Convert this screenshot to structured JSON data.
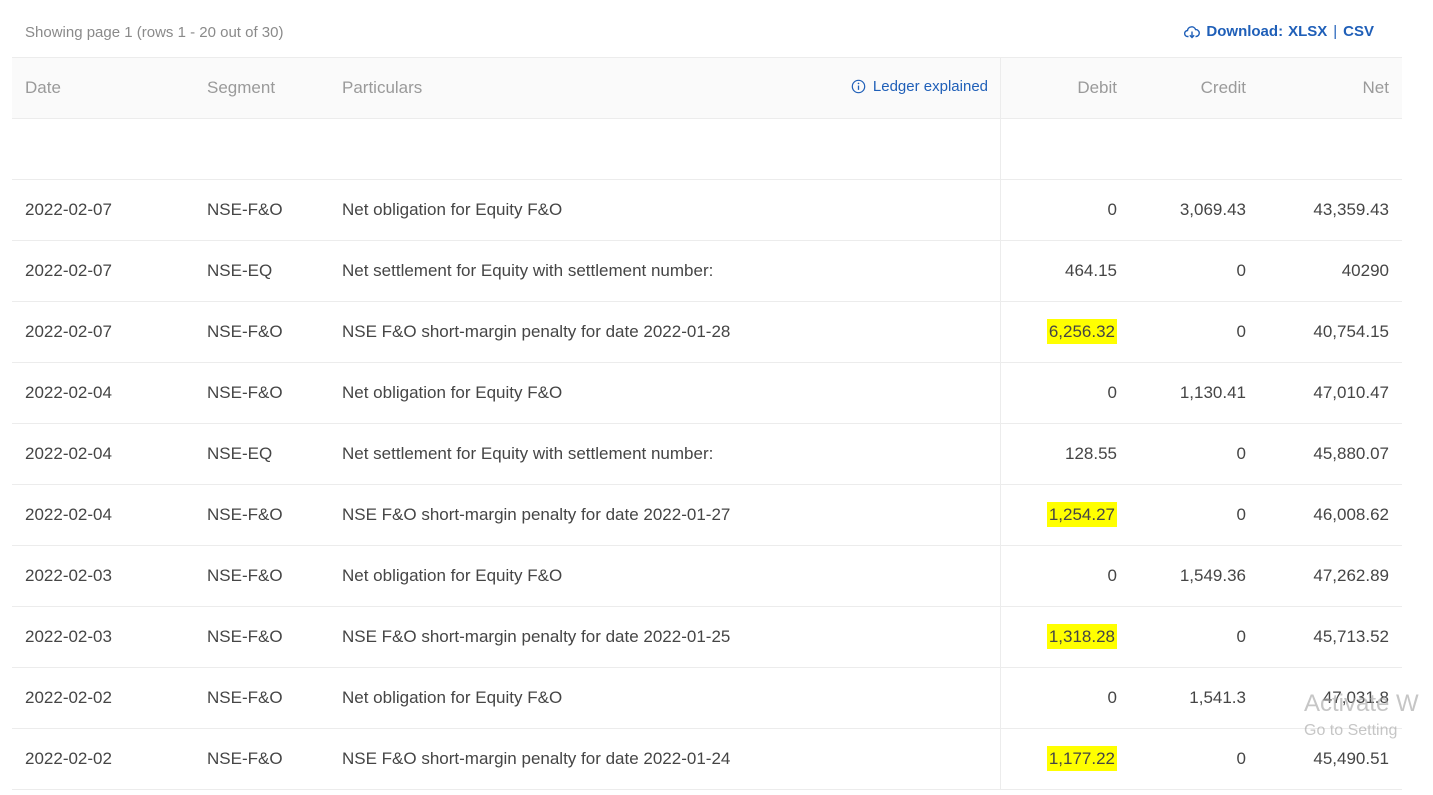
{
  "header": {
    "page_info": "Showing page 1 (rows 1 - 20 out of 30)",
    "download_label": "Download:",
    "xlsx": "XLSX",
    "separator": "|",
    "csv": "CSV"
  },
  "table": {
    "columns": {
      "date": "Date",
      "segment": "Segment",
      "particulars": "Particulars",
      "ledger_explained": "Ledger explained",
      "debit": "Debit",
      "credit": "Credit",
      "net": "Net"
    },
    "rows": [
      {
        "date": "",
        "segment": "",
        "particulars": "",
        "debit": "",
        "credit": "",
        "net": "",
        "highlight": false
      },
      {
        "date": "2022-02-07",
        "segment": "NSE-F&O",
        "particulars": "Net obligation for Equity F&O",
        "debit": "0",
        "credit": "3,069.43",
        "net": "43,359.43",
        "highlight": false
      },
      {
        "date": "2022-02-07",
        "segment": "NSE-EQ",
        "particulars": "Net settlement for Equity with settlement number:",
        "debit": "464.15",
        "credit": "0",
        "net": "40290",
        "highlight": false
      },
      {
        "date": "2022-02-07",
        "segment": "NSE-F&O",
        "particulars": "NSE F&O short-margin penalty for date 2022-01-28",
        "debit": "6,256.32",
        "credit": "0",
        "net": "40,754.15",
        "highlight": true
      },
      {
        "date": "2022-02-04",
        "segment": "NSE-F&O",
        "particulars": "Net obligation for Equity F&O",
        "debit": "0",
        "credit": "1,130.41",
        "net": "47,010.47",
        "highlight": false
      },
      {
        "date": "2022-02-04",
        "segment": "NSE-EQ",
        "particulars": "Net settlement for Equity with settlement number:",
        "debit": "128.55",
        "credit": "0",
        "net": "45,880.07",
        "highlight": false
      },
      {
        "date": "2022-02-04",
        "segment": "NSE-F&O",
        "particulars": "NSE F&O short-margin penalty for date 2022-01-27",
        "debit": "1,254.27",
        "credit": "0",
        "net": "46,008.62",
        "highlight": true
      },
      {
        "date": "2022-02-03",
        "segment": "NSE-F&O",
        "particulars": "Net obligation for Equity F&O",
        "debit": "0",
        "credit": "1,549.36",
        "net": "47,262.89",
        "highlight": false
      },
      {
        "date": "2022-02-03",
        "segment": "NSE-F&O",
        "particulars": "NSE F&O short-margin penalty for date 2022-01-25",
        "debit": "1,318.28",
        "credit": "0",
        "net": "45,713.52",
        "highlight": true
      },
      {
        "date": "2022-02-02",
        "segment": "NSE-F&O",
        "particulars": "Net obligation for Equity F&O",
        "debit": "0",
        "credit": "1,541.3",
        "net": "47,031.8",
        "highlight": false
      },
      {
        "date": "2022-02-02",
        "segment": "NSE-F&O",
        "particulars": "NSE F&O short-margin penalty for date 2022-01-24",
        "debit": "1,177.22",
        "credit": "0",
        "net": "45,490.51",
        "highlight": true
      }
    ]
  },
  "watermark": {
    "line1": "Activate W",
    "line2": "Go to Setting"
  },
  "colors": {
    "link": "#1f5fb8",
    "highlight": "#ffff00",
    "header_bg": "#fafafa"
  },
  "icons": {
    "download": "cloud-download-icon",
    "info": "info-icon"
  }
}
